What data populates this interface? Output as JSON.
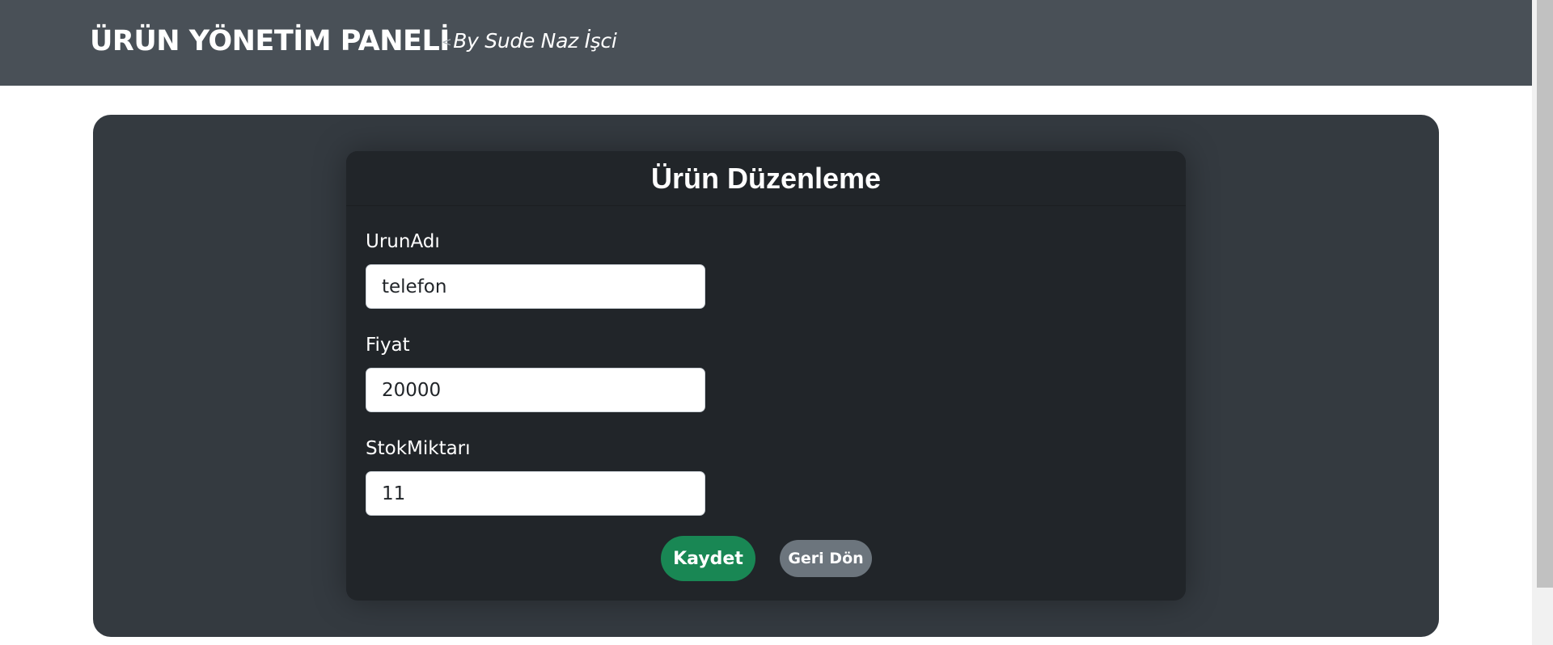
{
  "header": {
    "brand": "ÜRÜN YÖNETİM PANELİ",
    "byline_marker": "<",
    "byline": "By Sude Naz İşci"
  },
  "form": {
    "title": "Ürün Düzenleme",
    "fields": [
      {
        "label": "UrunAdı",
        "value": "telefon"
      },
      {
        "label": "Fiyat",
        "value": "20000"
      },
      {
        "label": "StokMiktarı",
        "value": "11"
      }
    ],
    "save_label": "Kaydet",
    "back_label": "Geri Dön"
  },
  "colors": {
    "header_bg": "#495057",
    "panel_bg": "#343a40",
    "card_bg": "#212529",
    "save_button": "#198754",
    "back_button": "#6c757d"
  }
}
